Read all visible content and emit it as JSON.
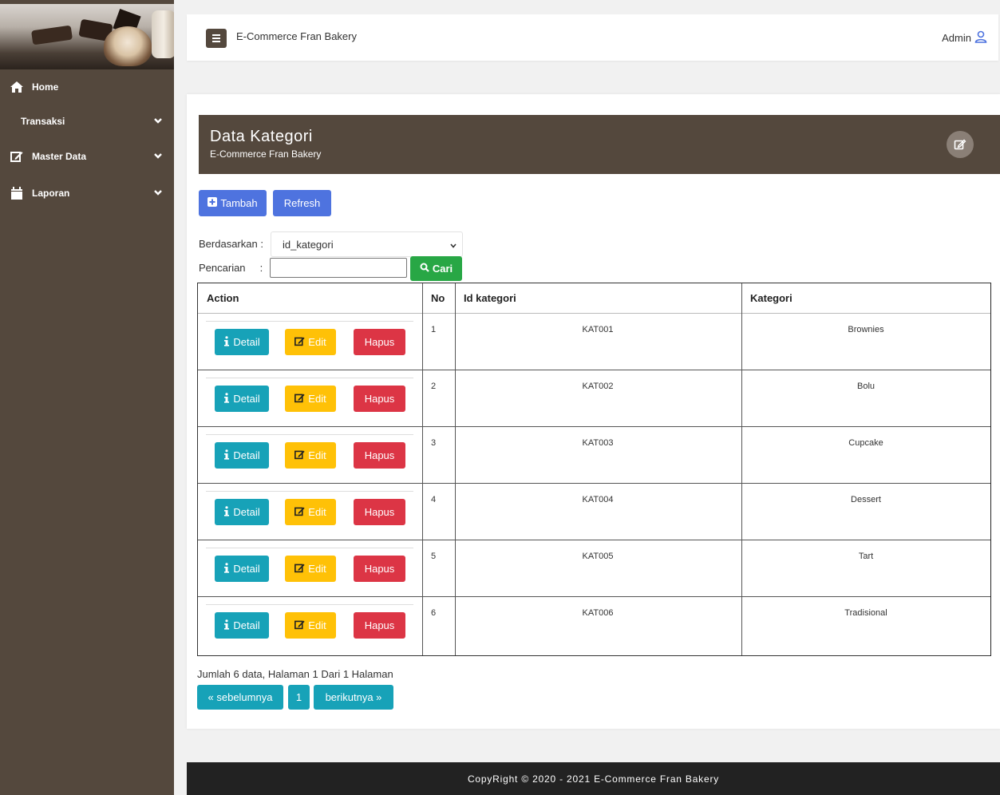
{
  "sidebar": {
    "items": [
      {
        "label": "Home",
        "icon": "home-icon"
      },
      {
        "label": "Transaksi",
        "icon": ""
      },
      {
        "label": "Master Data",
        "icon": "edit-icon"
      },
      {
        "label": "Laporan",
        "icon": "calendar-icon"
      }
    ]
  },
  "header": {
    "app_title": "E-Commerce Fran Bakery",
    "user_label": "Admin"
  },
  "card": {
    "title": "Data Kategori",
    "subtitle": "E-Commerce Fran Bakery"
  },
  "toolbar": {
    "tambah_label": "Tambah",
    "refresh_label": "Refresh"
  },
  "filter": {
    "berdasarkan_label": "Berdasarkan :",
    "selected_field": "id_kategori",
    "pencarian_label": "Pencarian     :",
    "search_value": "",
    "cari_label": "Cari"
  },
  "table": {
    "columns": [
      "Action",
      "No",
      "Id kategori",
      "Kategori"
    ],
    "action_labels": {
      "detail": "Detail",
      "edit": "Edit",
      "hapus": "Hapus"
    },
    "rows": [
      {
        "no": "1",
        "id": "KAT001",
        "kategori": "Brownies"
      },
      {
        "no": "2",
        "id": "KAT002",
        "kategori": "Bolu"
      },
      {
        "no": "3",
        "id": "KAT003",
        "kategori": "Cupcake"
      },
      {
        "no": "4",
        "id": "KAT004",
        "kategori": "Dessert"
      },
      {
        "no": "5",
        "id": "KAT005",
        "kategori": "Tart"
      },
      {
        "no": "6",
        "id": "KAT006",
        "kategori": "Tradisional"
      }
    ]
  },
  "pagination": {
    "summary": "Jumlah 6 data, Halaman 1 Dari 1 Halaman",
    "prev_label": "« sebelumnya",
    "page_label": "1",
    "next_label": "berikutnya »"
  },
  "footer": {
    "text": "CopyRight © 2020 - 2021 E-Commerce Fran Bakery"
  },
  "colors": {
    "sidebar": "#54483d",
    "primary": "#4e73df",
    "info": "#17a2b8",
    "warning": "#ffc107",
    "danger": "#dc3545",
    "success": "#28a745",
    "footer": "#222222"
  }
}
